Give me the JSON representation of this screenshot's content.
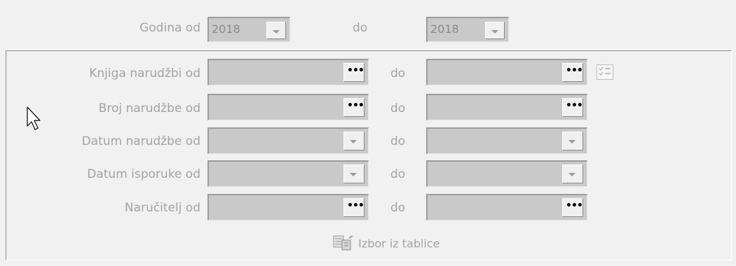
{
  "header": {
    "year_from_label": "Godina od",
    "year_from_value": "2018",
    "to_label": "do",
    "year_to_value": "2018"
  },
  "filters": [
    {
      "label": "Knjiga narudžbi od",
      "to_label": "do",
      "button": "..."
    },
    {
      "label": "Broj narudžbe od",
      "to_label": "do",
      "button": "..."
    },
    {
      "label": "Datum narudžbe od",
      "to_label": "do",
      "button": "dropdown"
    },
    {
      "label": "Datum isporuke od",
      "to_label": "do",
      "button": "dropdown"
    },
    {
      "label": "Naručitelj od",
      "to_label": "do",
      "button": "..."
    }
  ],
  "ellipsis": "•••",
  "table_select_label": "Izbor iz tablice",
  "icons": {
    "list": "checklist-icon",
    "table": "table-select-icon",
    "cursor": "mouse-cursor-icon"
  }
}
